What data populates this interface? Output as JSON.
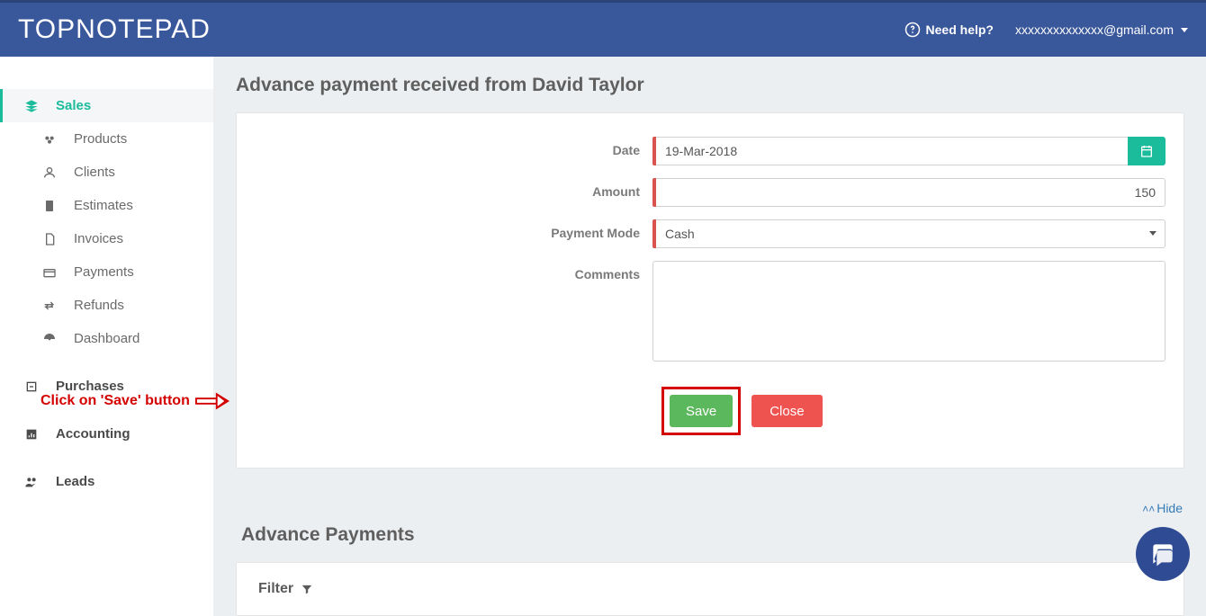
{
  "header": {
    "logo": "TOPNOTEPAD",
    "help_label": "Need help?",
    "user_email": "xxxxxxxxxxxxxx@gmail.com"
  },
  "sidebar": {
    "items": [
      {
        "label": "Sales",
        "type": "section-active"
      },
      {
        "label": "Products",
        "type": "sub"
      },
      {
        "label": "Clients",
        "type": "sub"
      },
      {
        "label": "Estimates",
        "type": "sub"
      },
      {
        "label": "Invoices",
        "type": "sub"
      },
      {
        "label": "Payments",
        "type": "sub"
      },
      {
        "label": "Refunds",
        "type": "sub"
      },
      {
        "label": "Dashboard",
        "type": "sub"
      },
      {
        "label": "Purchases",
        "type": "section"
      },
      {
        "label": "Accounting",
        "type": "section"
      },
      {
        "label": "Leads",
        "type": "section"
      }
    ]
  },
  "content": {
    "page_title": "Advance payment received from David Taylor",
    "form": {
      "date_label": "Date",
      "date_value": "19-Mar-2018",
      "amount_label": "Amount",
      "amount_value": "150",
      "payment_mode_label": "Payment Mode",
      "payment_mode_value": "Cash",
      "comments_label": "Comments",
      "comments_value": ""
    },
    "buttons": {
      "save": "Save",
      "close": "Close"
    },
    "annotation_text": "Click on 'Save' button",
    "hide_label": "Hide",
    "section_title": "Advance Payments",
    "filter_label": "Filter"
  }
}
